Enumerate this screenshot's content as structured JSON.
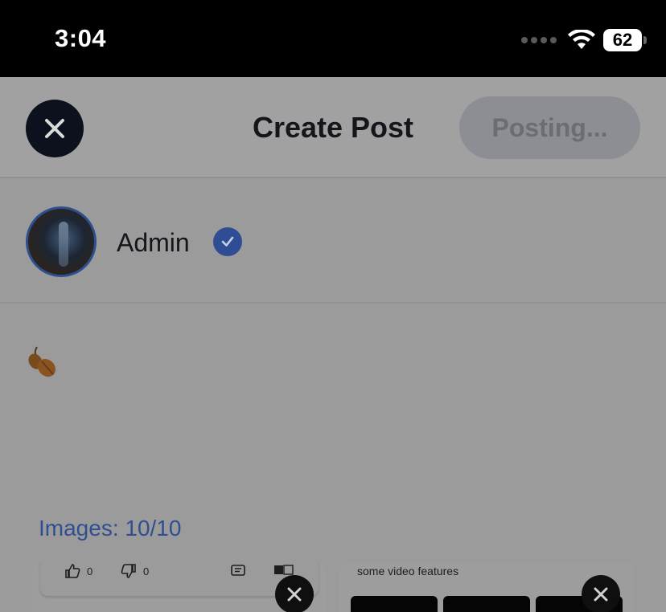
{
  "status_bar": {
    "time": "3:04",
    "battery": "62",
    "icons": [
      "cellular-signal-icon",
      "wifi-icon",
      "battery-icon"
    ]
  },
  "header": {
    "title": "Create Post",
    "close_icon": "close-icon",
    "posting_label": "Posting..."
  },
  "user": {
    "name": "Admin",
    "verified_icon": "verified-check-icon"
  },
  "post": {
    "content_emoji": "fallen-leaves-emoji"
  },
  "images": {
    "count_label": "Images: 10/10",
    "thumbnails": [
      {
        "likes": "0",
        "dislikes": "0",
        "icons": [
          "thumbs-up-icon",
          "thumbs-down-icon",
          "comment-icon",
          "translate-icon"
        ]
      },
      {
        "caption": "some video features"
      }
    ]
  },
  "colors": {
    "accent_blue": "#2f4f91",
    "overlay_gray": "#9b9b9b",
    "dark_button": "#0c111d"
  }
}
